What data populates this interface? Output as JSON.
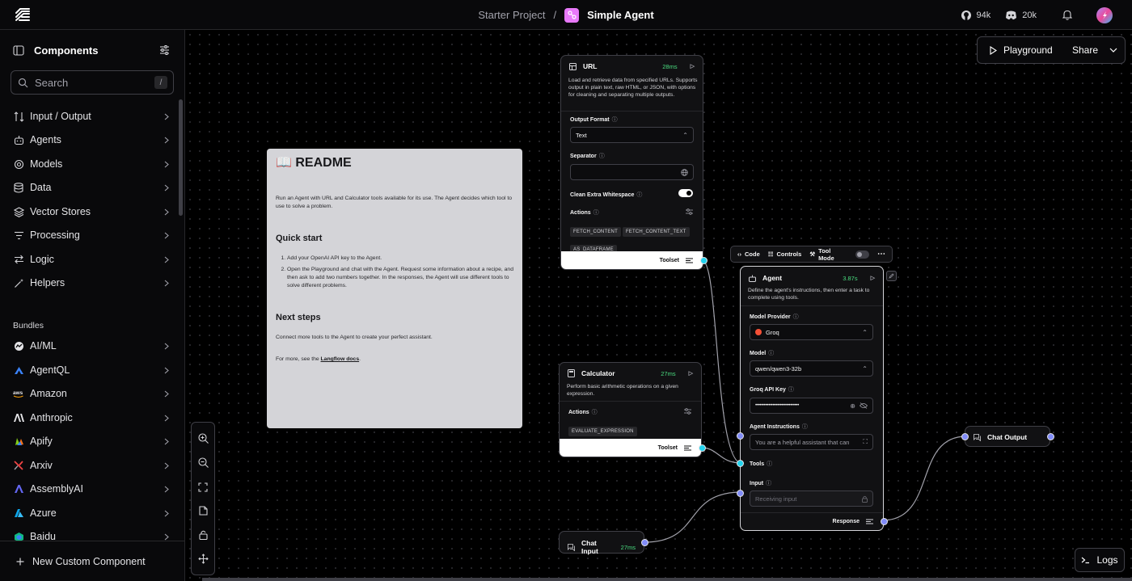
{
  "header": {
    "breadcrumb_project": "Starter Project",
    "breadcrumb_sep": "/",
    "flow_name": "Simple Agent",
    "github_stars": "94k",
    "discord_members": "20k"
  },
  "sidebar": {
    "title": "Components",
    "search_placeholder": "Search",
    "search_shortcut": "/",
    "categories": [
      {
        "label": "Input / Output",
        "icon": "input-output-icon"
      },
      {
        "label": "Agents",
        "icon": "bot-icon"
      },
      {
        "label": "Models",
        "icon": "models-icon"
      },
      {
        "label": "Data",
        "icon": "database-icon"
      },
      {
        "label": "Vector Stores",
        "icon": "layers-icon"
      },
      {
        "label": "Processing",
        "icon": "list-filter-icon"
      },
      {
        "label": "Logic",
        "icon": "arrows-icon"
      },
      {
        "label": "Helpers",
        "icon": "wand-icon"
      }
    ],
    "bundles_label": "Bundles",
    "bundles": [
      {
        "label": "AI/ML",
        "color": "#e4e4e7"
      },
      {
        "label": "AgentQL",
        "color": "#3b82f6"
      },
      {
        "label": "Amazon",
        "color": "#f59e0b"
      },
      {
        "label": "Anthropic",
        "color": "#e4e4e7"
      },
      {
        "label": "Apify",
        "color": "#84cc16"
      },
      {
        "label": "Arxiv",
        "color": "#ef4444"
      },
      {
        "label": "AssemblyAI",
        "color": "#6366f1"
      },
      {
        "label": "Azure",
        "color": "#0ea5e9"
      },
      {
        "label": "Baidu",
        "color": "#10b981"
      }
    ],
    "footer_label": "New Custom Component"
  },
  "toolbar": {
    "playground_label": "Playground",
    "share_label": "Share",
    "logs_label": "Logs"
  },
  "readme": {
    "title": "📖 README",
    "intro": "Run an Agent with URL and Calculator tools available for its use. The Agent decides which tool to use to solve a problem.",
    "quick_start_heading": "Quick start",
    "steps": [
      "Add your OpenAI API key to the Agent.",
      "Open the Playground and chat with the Agent. Request some information about a recipe, and then ask to add two numbers together. In the responses, the Agent will use different tools to solve different problems."
    ],
    "next_steps_heading": "Next steps",
    "next_steps_text": "Connect more tools to the Agent to create your perfect assistant.",
    "more_prefix": "For more, see the ",
    "docs_link": "Langflow docs",
    "more_suffix": "."
  },
  "nodes": {
    "url": {
      "title": "URL",
      "time": "28ms",
      "description": "Load and retrieve data from specified URLs. Supports output in plain text, raw HTML, or JSON, with options for cleaning and separating multiple outputs.",
      "output_format_label": "Output Format",
      "output_format_value": "Text",
      "separator_label": "Separator",
      "clean_whitespace_label": "Clean Extra Whitespace",
      "actions_label": "Actions",
      "actions": [
        "FETCH_CONTENT",
        "FETCH_CONTENT_TEXT",
        "AS_DATAFRAME"
      ],
      "output_label": "Toolset"
    },
    "calculator": {
      "title": "Calculator",
      "time": "27ms",
      "description": "Perform basic arithmetic operations on a given expression.",
      "actions_label": "Actions",
      "actions": [
        "EVALUATE_EXPRESSION"
      ],
      "output_label": "Toolset"
    },
    "agent_toolbar": {
      "code": "Code",
      "controls": "Controls",
      "tool_mode": "Tool Mode"
    },
    "agent": {
      "title": "Agent",
      "time": "3.87s",
      "description": "Define the agent's instructions, then enter a task to complete using tools.",
      "model_provider_label": "Model Provider",
      "model_provider_value": "Groq",
      "model_label": "Model",
      "model_value": "qwen/qwen3-32b",
      "api_key_label": "Groq API Key",
      "api_key_value": "••••••••••••••••••••••••••••••",
      "instructions_label": "Agent Instructions",
      "instructions_value": "You are a helpful assistant that can",
      "tools_label": "Tools",
      "input_label": "Input",
      "input_placeholder": "Receiving input",
      "output_label": "Response"
    },
    "chat_input": {
      "title": "Chat Input",
      "time": "27ms"
    },
    "chat_output": {
      "title": "Chat Output"
    }
  }
}
